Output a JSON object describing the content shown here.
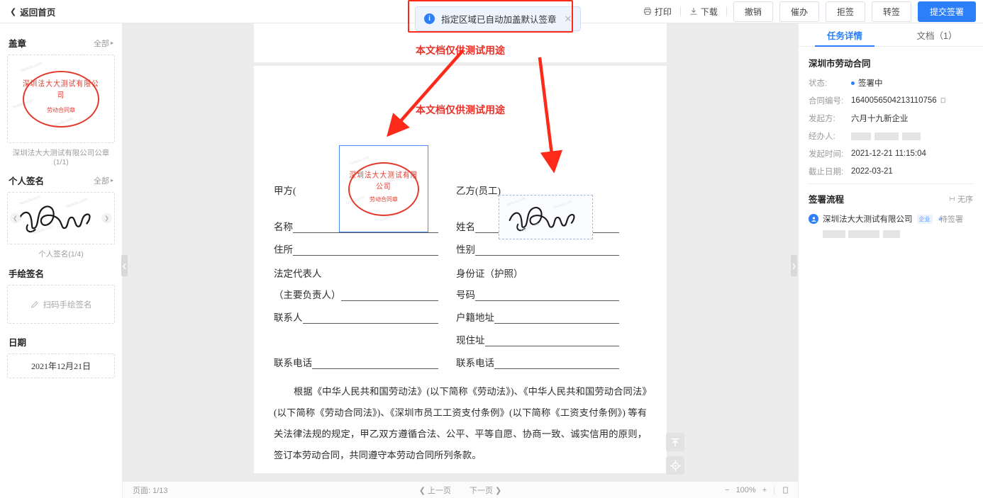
{
  "topbar": {
    "back_label": "返回首页",
    "print_label": "打印",
    "download_label": "下载",
    "buttons": [
      {
        "label": "撤销"
      },
      {
        "label": "催办"
      },
      {
        "label": "拒签"
      },
      {
        "label": "转签"
      }
    ],
    "primary_label": "提交签署"
  },
  "toast": {
    "message": "指定区域已自动加盖默认签章",
    "info_glyph": "i",
    "close_glyph": "✕"
  },
  "sidebar": {
    "seal_section": {
      "title": "盖章",
      "all_label": "全部",
      "caption": "深圳法大大测试有限公司公章(1/1)",
      "seal_top_text": "深圳法大大测试有限公司",
      "seal_mid_text": "劳动合同章"
    },
    "signature_section": {
      "title": "个人签名",
      "all_label": "全部",
      "caption": "个人签名(1/4)"
    },
    "handdraw_section": {
      "title": "手绘签名",
      "placeholder": "扫码手绘签名"
    },
    "date_section": {
      "title": "日期",
      "value": "2021年12月21日"
    }
  },
  "document": {
    "watermark_top": "本文档仅供测试用途",
    "watermark_second": "本文档仅供测试用途",
    "party_a_label": "甲方(",
    "party_b_label": "乙方(员工)",
    "left_fields": [
      {
        "label": "名称",
        "underline": true
      },
      {
        "label": "住所",
        "underline": true
      },
      {
        "label": "法定代表人",
        "underline": false
      },
      {
        "label": "（主要负责人）",
        "underline": true
      },
      {
        "label": "联系人",
        "underline": true
      },
      {
        "label": "",
        "underline": false
      },
      {
        "label": "联系电话",
        "underline": true
      }
    ],
    "right_fields": [
      {
        "label": "姓名",
        "underline": true
      },
      {
        "label": "性别",
        "underline": true
      },
      {
        "label": "身份证（护照）",
        "underline": false
      },
      {
        "label": "号码",
        "underline": true
      },
      {
        "label": "户籍地址",
        "underline": true
      },
      {
        "label": "现住址",
        "underline": true
      },
      {
        "label": "联系电话",
        "underline": true
      }
    ],
    "paragraph": "根据《中华人民共和国劳动法》(以下简称《劳动法》)、《中华人民共和国劳动合同法》(以下简称《劳动合同法》)、《深圳市员工工资支付条例》(以下简称《工资支付条例》) 等有关法律法规的规定，甲乙双方遵循合法、公平、平等自愿、协商一致、诚实信用的原则，签订本劳动合同，共同遵守本劳动合同所列条款。",
    "seal_top_text": "深圳法大大测试有限公司",
    "seal_mid_text": "劳动合同章"
  },
  "bottombar": {
    "page_label": "页面: 1/13",
    "prev_label": "上一页",
    "next_label": "下一页",
    "zoom_out": "−",
    "zoom_level": "100%",
    "zoom_in": "+"
  },
  "right_panel": {
    "tabs": [
      {
        "label": "任务详情",
        "active": true
      },
      {
        "label": "文档（1）",
        "active": false
      }
    ],
    "doc_title": "深圳市劳动合同",
    "details": [
      {
        "key": "状态:",
        "value": "签署中",
        "type": "status"
      },
      {
        "key": "合同编号:",
        "value": "1640056504213110756",
        "type": "copy"
      },
      {
        "key": "发起方:",
        "value": "六月十九新企业",
        "type": "text"
      },
      {
        "key": "经办人:",
        "value": "",
        "type": "masked"
      },
      {
        "key": "发起时间:",
        "value": "2021-12-21 11:15:04",
        "type": "text"
      },
      {
        "key": "截止日期:",
        "value": "2022-03-21",
        "type": "text"
      }
    ],
    "flow": {
      "title": "签署流程",
      "order_label": "无序",
      "participant": "深圳法大大测试有限公司",
      "tag": "企业",
      "state": "待签署"
    }
  },
  "colors": {
    "accent": "#2d7ff9",
    "seal_red": "#e23b2e",
    "annotation_red": "#fe2a19"
  }
}
